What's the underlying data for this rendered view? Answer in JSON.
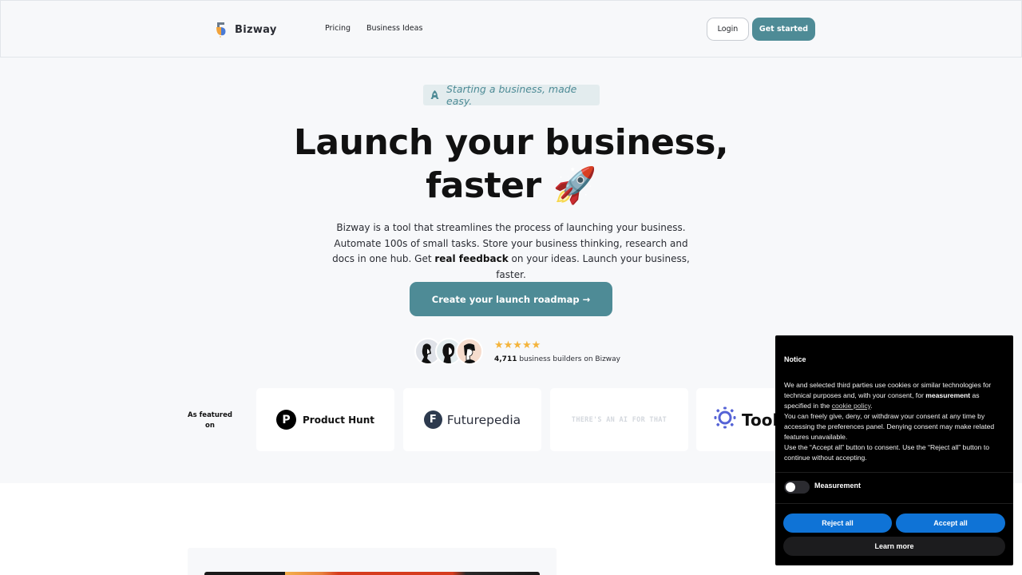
{
  "navbar": {
    "brand": "Bizway",
    "links": [
      "Pricing",
      "Business Ideas"
    ],
    "login_label": "Login",
    "get_started_label": "Get started"
  },
  "hero": {
    "tagline": "Starting a business, made easy.",
    "headline_line1": "Launch your business,",
    "headline_line2": "faster",
    "headline_emoji": "🚀",
    "description_part1": "Bizway is a tool that streamlines the process of launching your business. Automate 100s of small tasks. Store your business thinking, research and docs in one hub. Get ",
    "description_bold": "real feedback",
    "description_part2": " on your ideas. Launch your business, faster.",
    "cta_label": "Create your launch roadmap →",
    "rating_stars": 5,
    "stars_glyph": "★★★★★",
    "builders_count": "4,711",
    "builders_text": " business builders on Bizway"
  },
  "featured": {
    "label": "As featured on",
    "items": [
      {
        "name": "Product Hunt",
        "glyph": "P"
      },
      {
        "name": "Futurepedia",
        "glyph": "F"
      },
      {
        "name": "THERE'S AN AI FOR THAT"
      },
      {
        "name": "Tools"
      }
    ]
  },
  "cookie_notice": {
    "title": "Notice",
    "text1": "We and selected third parties use cookies or similar technologies for technical purposes and, with your consent, for ",
    "text1_bold": "measurement",
    "text2": " as specified in the ",
    "policy_link": "cookie policy",
    "text3": ".",
    "text4": "You can freely give, deny, or withdraw your consent at any time by accessing the preferences panel. Denying consent may make related features unavailable.",
    "text5": "Use the “Accept all” button to consent. Use the “Reject all” button to continue without accepting.",
    "toggle_label": "Measurement",
    "toggle_on": false,
    "reject_label": "Reject all",
    "accept_label": "Accept all",
    "learn_label": "Learn more"
  },
  "colors": {
    "brand": "#4e8b96",
    "consent_button": "#0f73d6",
    "star": "#f4b43c"
  }
}
